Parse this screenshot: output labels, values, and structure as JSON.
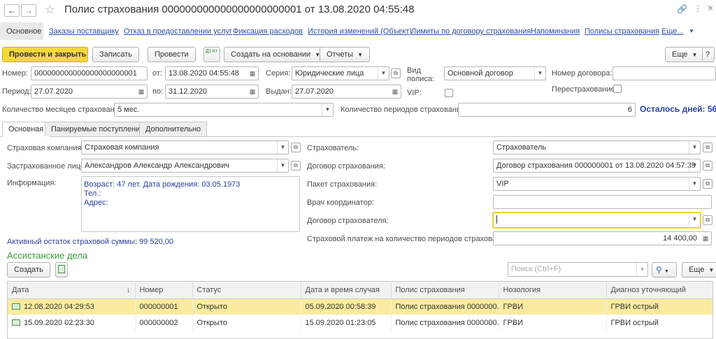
{
  "window": {
    "title": "Полис страхования 000000000000000000000001 от 13.08.2020 04:55:48"
  },
  "nav": {
    "main": "Основное",
    "links": [
      "Заказы поставщику",
      "Отказ в предоставлении услуг",
      "Фиксация расходов",
      "История изменений (Объект)",
      "Лимиты по договору страхования",
      "Напоминания",
      "Полисы страхования",
      "Еще..."
    ]
  },
  "toolbar": {
    "post_close": "Провести и закрыть",
    "save": "Записать",
    "post": "Провести",
    "dtkt": "Дт Кт",
    "create_based": "Создать на основании",
    "reports": "Отчеты",
    "more": "Еще"
  },
  "header": {
    "number_label": "Номер:",
    "number": "000000000000000000000001",
    "from_label": "от:",
    "from": "13.08.2020 04:55:48",
    "series_label": "Серия:",
    "series": "Юридические лица",
    "policy_type_label": "Вид полиса:",
    "policy_type": "Основной договор",
    "contract_no_label": "Номер договора:",
    "vip_label": "VIP:",
    "period_label": "Период:",
    "period_start": "27.07.2020",
    "to_label": "по:",
    "period_end": "31.12.2020",
    "issued_label": "Выдан:",
    "issued": "27.07.2020",
    "reinsurance_label": "Перестрахование:",
    "months_label": "Количество месяцев страхования:",
    "months": "5 мес.",
    "periods_label": "Количество периодов страхования:",
    "periods": "6",
    "days_left": "Осталось дней: 56"
  },
  "tabs": [
    "Основная",
    "Панируемые поступления",
    "Дополнительно"
  ],
  "main": {
    "company_label": "Страховая компания:",
    "company": "Страховая компания",
    "insured_label": "Застрахованное лицо:",
    "insured": "Александров Александр Александрович",
    "info_label": "Информация:",
    "info_lines": [
      "Возраст: 47 лет.  Дата рождения: 03.05.1973",
      "Тел.:",
      "Адрес:"
    ],
    "balance": "Активный остаток страховой суммы: 99 520,00",
    "policyholder_label": "Страхователь:",
    "policyholder": "Страхователь",
    "contract_label": "Договор страхования:",
    "contract": "Договор страхования 000000001 от 13.08.2020 04:57:39",
    "package_label": "Пакет страхования:",
    "package": "VIP",
    "doctor_label": "Врач координатор:",
    "ph_contract_label": "Договор страхователя:",
    "payment_label": "Страховой платеж на количество периодов страхования:",
    "payment": "14 400,00"
  },
  "assist": {
    "title": "Ассистанские дела",
    "create": "Создать",
    "search_placeholder": "Поиск (Ctrl+F)",
    "more": "Еще",
    "columns": [
      "Дата",
      "Номер",
      "Статус",
      "Дата и время случая",
      "Полис страхования",
      "Нозология",
      "Диагноз уточняющий"
    ],
    "rows": [
      [
        "12.08.2020 04:29:53",
        "000000001",
        "Открыто",
        "05.09.2020 00:58:39",
        "Полис страхования 0000000...",
        "ГРВИ",
        "ГРВИ острый"
      ],
      [
        "15.09.2020 02:23:30",
        "000000002",
        "Открыто",
        "15.09.2020 01:23:05",
        "Полис страхования 0000000...",
        "ГРВИ",
        "ГРВИ острый"
      ]
    ]
  },
  "colors": {
    "accent": "#f5d83a",
    "link": "#2a4fa3",
    "section": "#3b9a3b",
    "selected": "#fbeba0"
  }
}
